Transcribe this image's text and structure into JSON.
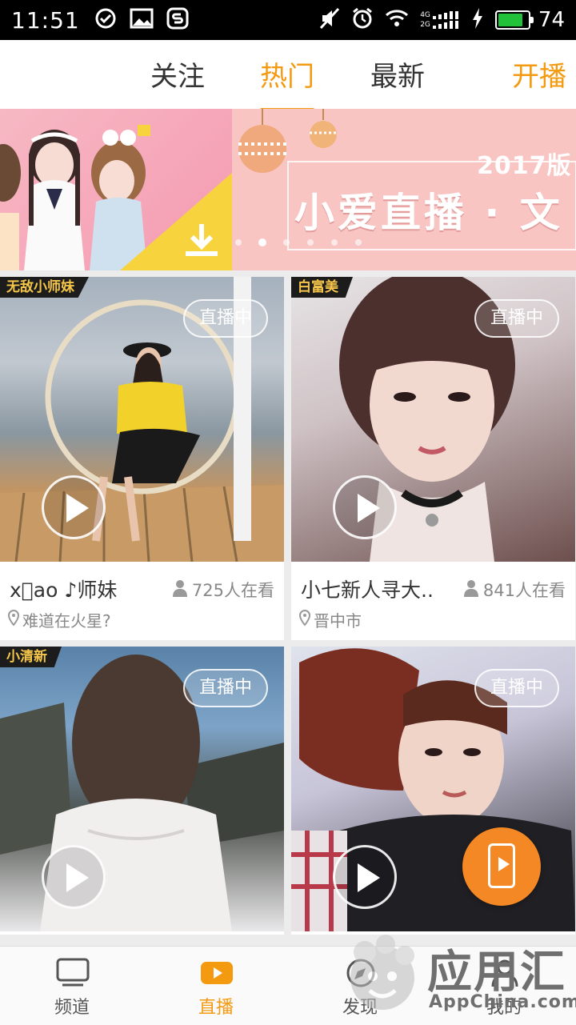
{
  "status_bar": {
    "time": "11:51",
    "network_top": "4G",
    "network_bottom": "2G",
    "battery": "74",
    "battery_color": "#22c33a"
  },
  "top_tabs": {
    "follow": "关注",
    "hot": "热门",
    "latest": "最新",
    "start_live": "开播",
    "active": "hot",
    "accent_color": "#f39a11"
  },
  "banner": {
    "year_text": "2017版",
    "title": "小爱直播 · 文",
    "dots_count": 7,
    "active_dot": 2
  },
  "cards": [
    {
      "tag": "无敌小师妹",
      "status": "直播中",
      "name": "x\u0000ao ♪师妹",
      "viewers": "725人在看",
      "location": "难道在火星?"
    },
    {
      "tag": "白富美",
      "status": "直播中",
      "name": "小七新人寻大..",
      "viewers": "841人在看",
      "location": "晋中市"
    },
    {
      "tag": "小清新",
      "status": "直播中"
    },
    {
      "tag": "",
      "status": "直播中"
    }
  ],
  "bottom_nav": {
    "channel": "频道",
    "live": "直播",
    "discover": "发现",
    "mine": "我的",
    "active": "live"
  },
  "watermark": {
    "title": "应用汇",
    "sub": "AppChina.com"
  },
  "icons": {
    "fab": "phone-play-icon"
  }
}
